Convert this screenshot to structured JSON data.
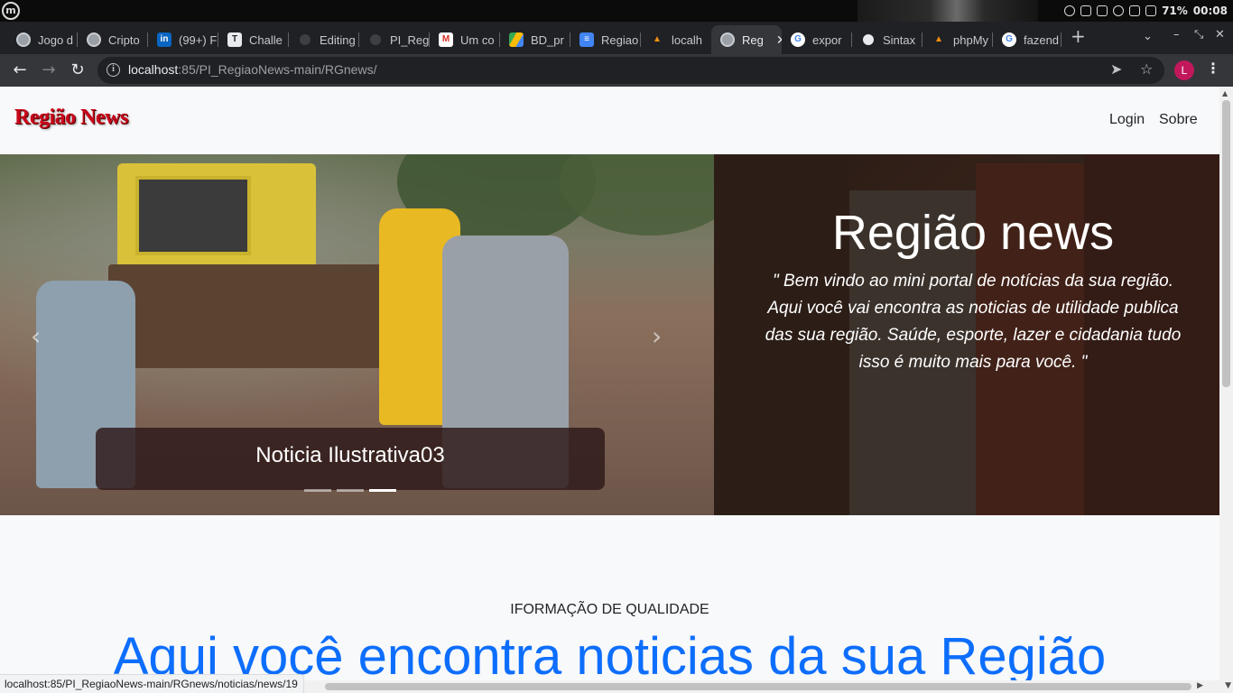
{
  "os": {
    "logo": "m",
    "battery": "71%",
    "clock": "00:08"
  },
  "tabs": [
    {
      "label": "Jogo d",
      "icon": "globe-icon"
    },
    {
      "label": "Cripto",
      "icon": "globe-icon"
    },
    {
      "label": "(99+) F",
      "icon": "linkedin-icon"
    },
    {
      "label": "Challe",
      "icon": "trello-icon"
    },
    {
      "label": "Editing",
      "icon": "github-icon"
    },
    {
      "label": "PI_Reg",
      "icon": "github-icon"
    },
    {
      "label": "Um co",
      "icon": "gmail-icon"
    },
    {
      "label": "BD_pr",
      "icon": "drive-icon"
    },
    {
      "label": "Regiao",
      "icon": "docs-icon"
    },
    {
      "label": "localh",
      "icon": "phpmyadmin-icon"
    },
    {
      "label": "Reg",
      "icon": "globe-icon",
      "active": true
    },
    {
      "label": "expor",
      "icon": "google-icon"
    },
    {
      "label": "Sintax",
      "icon": "github-icon"
    },
    {
      "label": "phpMy",
      "icon": "phpmyadmin-icon"
    },
    {
      "label": "fazend",
      "icon": "google-icon"
    }
  ],
  "toolbar": {
    "url_host": "localhost",
    "url_path": ":85/PI_RegiaoNews-main/RGnews/",
    "avatar_letter": "L"
  },
  "site": {
    "brand": "Região News",
    "nav": [
      "Login",
      "Sobre"
    ],
    "carousel": {
      "caption": "Noticia Ilustrativa03",
      "slides": 3,
      "active_slide": 3
    },
    "intro": {
      "title": "Região news",
      "text": "\" Bem vindo ao mini portal de notícias da sua região. Aqui você vai encontra as noticias de utilidade publica das sua região. Saúde, esporte, lazer e cidadania tudo isso é muito mais para você. \""
    },
    "kicker": "IFORMAÇÃO DE QUALIDADE",
    "headline": "Aqui você encontra noticias da sua Região"
  },
  "status_bar": {
    "link": "localhost:85/PI_RegiaoNews-main/RGnews/noticias/news/19"
  },
  "colors": {
    "brand_red": "#c9061a",
    "headline_blue": "#0d6efd",
    "chrome_dark": "#202124",
    "chrome_toolbar": "#35363a"
  }
}
